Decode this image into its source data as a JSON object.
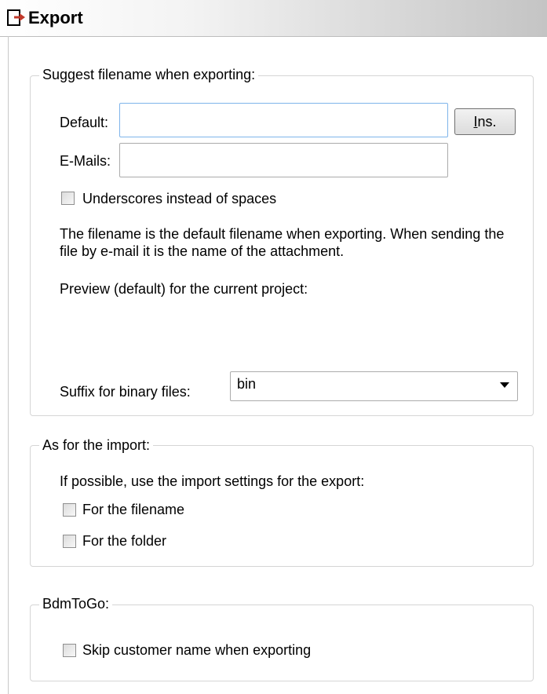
{
  "header": {
    "title": "Export"
  },
  "suggest": {
    "legend": "Suggest filename when exporting:",
    "default_label": "Default:",
    "default_value": "",
    "ins_button": "Ins.",
    "emails_label": "E-Mails:",
    "emails_value": "",
    "underscores_label": "Underscores instead of spaces",
    "underscores_checked": false,
    "info_text": "The filename is the default filename when exporting. When sending the file by e-mail it is the name of the attachment.",
    "preview_label": "Preview (default) for the current project:",
    "suffix_label": "Suffix for binary files:",
    "suffix_value": "bin"
  },
  "import_group": {
    "legend": "As for the import:",
    "description": "If possible, use the import settings for the export:",
    "filename_label": "For the filename",
    "filename_checked": false,
    "folder_label": "For the folder",
    "folder_checked": false
  },
  "bdmtogo": {
    "legend": "BdmToGo:",
    "skip_label": "Skip customer name when exporting",
    "skip_checked": false
  }
}
